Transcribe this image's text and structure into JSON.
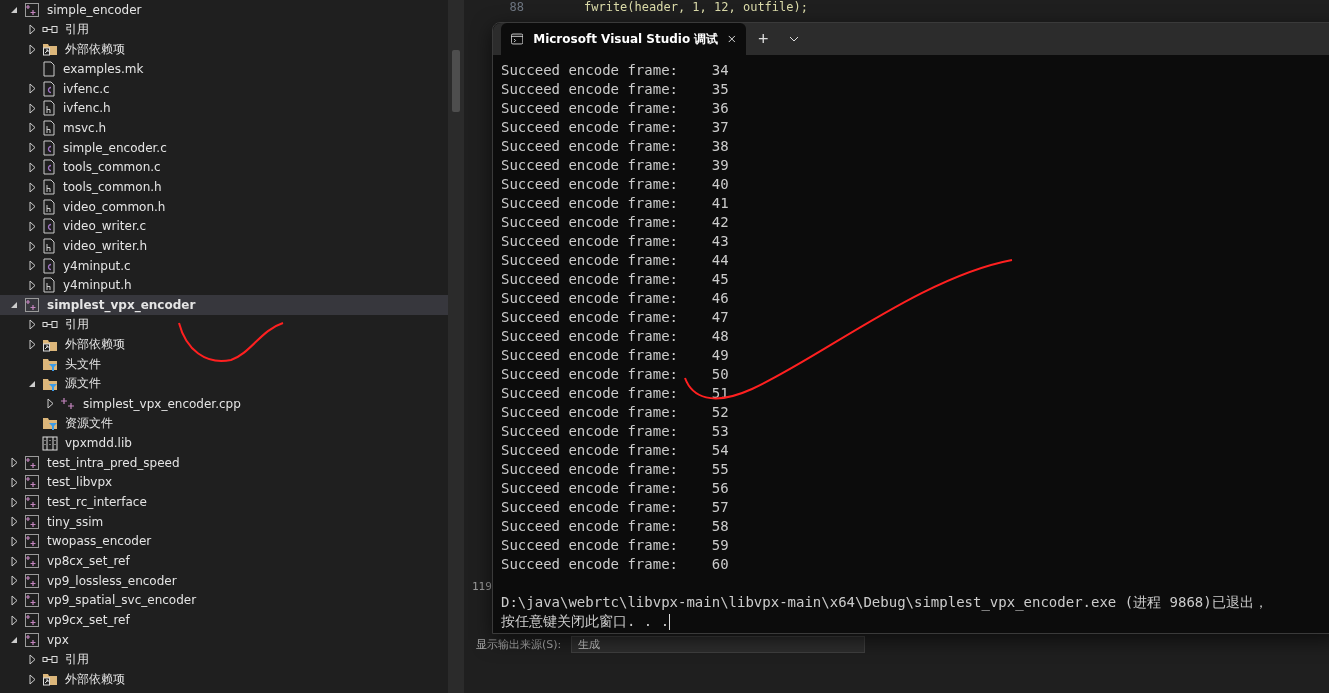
{
  "solution_tree": [
    {
      "label": "simple_encoder",
      "kind": "project",
      "expanded": true,
      "selected": false,
      "children": [
        {
          "label": "引用",
          "kind": "reference",
          "expanded": false,
          "selected": false
        },
        {
          "label": "外部依赖项",
          "kind": "deps",
          "expanded": false,
          "selected": false
        },
        {
          "label": "examples.mk",
          "kind": "file-plain",
          "selected": false
        },
        {
          "label": "ivfenc.c",
          "kind": "file-c",
          "expanded": false,
          "selected": false
        },
        {
          "label": "ivfenc.h",
          "kind": "file-h",
          "expanded": false,
          "selected": false
        },
        {
          "label": "msvc.h",
          "kind": "file-h",
          "expanded": false,
          "selected": false
        },
        {
          "label": "simple_encoder.c",
          "kind": "file-c",
          "expanded": false,
          "selected": false
        },
        {
          "label": "tools_common.c",
          "kind": "file-c",
          "expanded": false,
          "selected": false
        },
        {
          "label": "tools_common.h",
          "kind": "file-h",
          "expanded": false,
          "selected": false
        },
        {
          "label": "video_common.h",
          "kind": "file-h",
          "expanded": false,
          "selected": false
        },
        {
          "label": "video_writer.c",
          "kind": "file-c",
          "expanded": false,
          "selected": false
        },
        {
          "label": "video_writer.h",
          "kind": "file-h",
          "expanded": false,
          "selected": false
        },
        {
          "label": "y4minput.c",
          "kind": "file-c",
          "expanded": false,
          "selected": false
        },
        {
          "label": "y4minput.h",
          "kind": "file-h",
          "expanded": false,
          "selected": false
        }
      ]
    },
    {
      "label": "simplest_vpx_encoder",
      "kind": "project",
      "expanded": true,
      "selected": true,
      "children": [
        {
          "label": "引用",
          "kind": "reference",
          "expanded": false,
          "selected": false
        },
        {
          "label": "外部依赖项",
          "kind": "deps",
          "expanded": false,
          "selected": false
        },
        {
          "label": "头文件",
          "kind": "filter",
          "selected": false
        },
        {
          "label": "源文件",
          "kind": "filter",
          "expanded": true,
          "selected": false,
          "children": [
            {
              "label": "simplest_vpx_encoder.cpp",
              "kind": "cpp",
              "expanded": false,
              "selected": false
            }
          ]
        },
        {
          "label": "资源文件",
          "kind": "filter",
          "selected": false
        },
        {
          "label": "vpxmdd.lib",
          "kind": "lib",
          "selected": false
        }
      ]
    },
    {
      "label": "test_intra_pred_speed",
      "kind": "project",
      "expanded": false,
      "selected": false
    },
    {
      "label": "test_libvpx",
      "kind": "project",
      "expanded": false,
      "selected": false
    },
    {
      "label": "test_rc_interface",
      "kind": "project",
      "expanded": false,
      "selected": false
    },
    {
      "label": "tiny_ssim",
      "kind": "project",
      "expanded": false,
      "selected": false
    },
    {
      "label": "twopass_encoder",
      "kind": "project",
      "expanded": false,
      "selected": false
    },
    {
      "label": "vp8cx_set_ref",
      "kind": "project",
      "expanded": false,
      "selected": false
    },
    {
      "label": "vp9_lossless_encoder",
      "kind": "project",
      "expanded": false,
      "selected": false
    },
    {
      "label": "vp9_spatial_svc_encoder",
      "kind": "project",
      "expanded": false,
      "selected": false
    },
    {
      "label": "vp9cx_set_ref",
      "kind": "project",
      "expanded": false,
      "selected": false
    },
    {
      "label": "vpx",
      "kind": "project",
      "expanded": true,
      "selected": false,
      "children": [
        {
          "label": "引用",
          "kind": "reference",
          "expanded": false,
          "selected": false
        },
        {
          "label": "外部依赖项",
          "kind": "deps",
          "expanded": false,
          "selected": false
        }
      ]
    }
  ],
  "editor": {
    "line_number": "88",
    "code": "fwrite(header, 1, 12, outfile);",
    "side_line_number": "119",
    "output_label": "显示输出来源(S):",
    "output_source": "生成"
  },
  "terminal": {
    "tab_title": "Microsoft Visual Studio 调试",
    "new_tab": "+",
    "lines": [
      "Succeed encode frame:    34",
      "Succeed encode frame:    35",
      "Succeed encode frame:    36",
      "Succeed encode frame:    37",
      "Succeed encode frame:    38",
      "Succeed encode frame:    39",
      "Succeed encode frame:    40",
      "Succeed encode frame:    41",
      "Succeed encode frame:    42",
      "Succeed encode frame:    43",
      "Succeed encode frame:    44",
      "Succeed encode frame:    45",
      "Succeed encode frame:    46",
      "Succeed encode frame:    47",
      "Succeed encode frame:    48",
      "Succeed encode frame:    49",
      "Succeed encode frame:    50",
      "Succeed encode frame:    51",
      "Succeed encode frame:    52",
      "Succeed encode frame:    53",
      "Succeed encode frame:    54",
      "Succeed encode frame:    55",
      "Succeed encode frame:    56",
      "Succeed encode frame:    57",
      "Succeed encode frame:    58",
      "Succeed encode frame:    59",
      "Succeed encode frame:    60"
    ],
    "exit_lines": [
      "D:\\java\\webrtc\\libvpx-main\\libvpx-main\\x64\\Debug\\simplest_vpx_encoder.exe (进程 9868)已退出，",
      "按任意键关闭此窗口. . ."
    ]
  }
}
